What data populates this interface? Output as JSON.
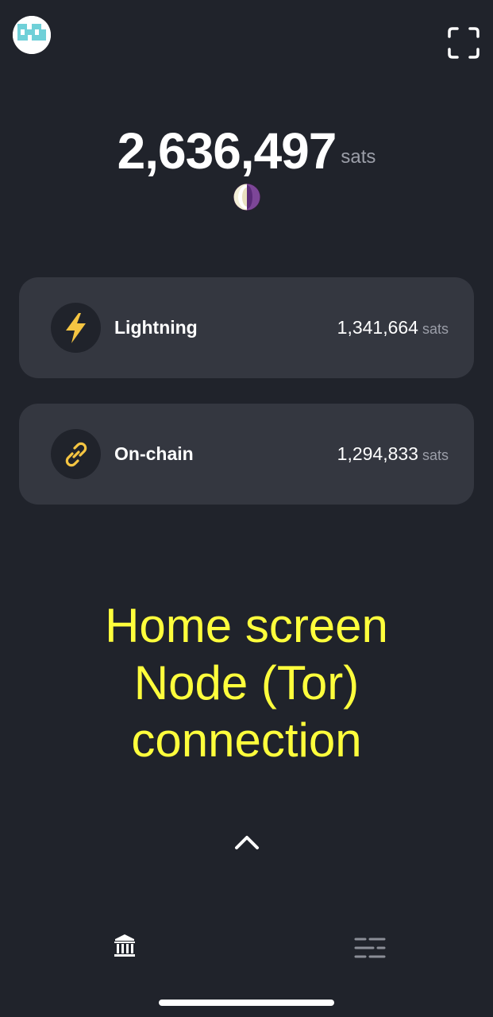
{
  "balance": {
    "amount": "2,636,497",
    "unit": "sats"
  },
  "accounts": [
    {
      "label": "Lightning",
      "amount": "1,341,664",
      "unit": "sats",
      "icon": "lightning-bolt-icon"
    },
    {
      "label": "On-chain",
      "amount": "1,294,833",
      "unit": "sats",
      "icon": "chain-link-icon"
    }
  ],
  "overlay_caption": {
    "line1": "Home screen",
    "line2": "Node (Tor)",
    "line3": "connection"
  },
  "icons": {
    "avatar": "avatar-identicon",
    "scan": "qr-scan-icon",
    "tor": "tor-onion-icon",
    "expand": "chevron-up-icon",
    "tab_wallet": "bank-icon",
    "tab_activity": "list-icon"
  },
  "colors": {
    "background": "#20232b",
    "card": "#343740",
    "accent": "#f5c542",
    "caption": "#ffff3c",
    "muted_text": "#9b9ea8"
  }
}
